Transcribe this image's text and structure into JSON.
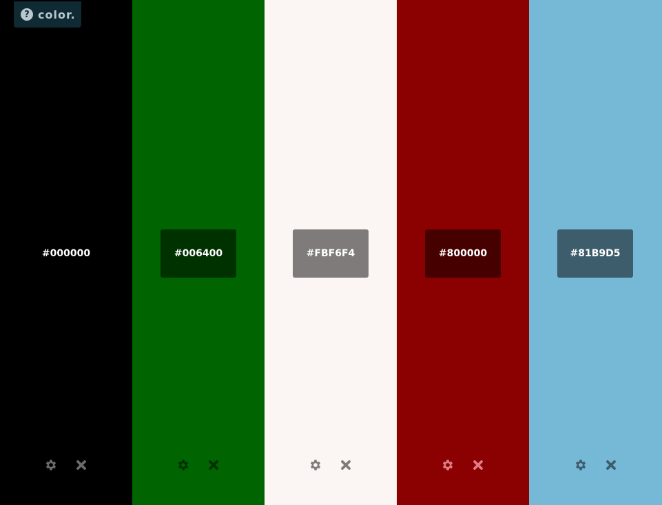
{
  "app": {
    "logo_text": "color.",
    "help_glyph": "?"
  },
  "colors": [
    {
      "hex": "#000000",
      "background": "#000000",
      "label_bg": "#000000",
      "icon_color": "#6b6b6b"
    },
    {
      "hex": "#006400",
      "background": "#006400",
      "label_bg": "#003200",
      "icon_color": "#003200"
    },
    {
      "hex": "#FBF6F4",
      "background": "#FBF6F4",
      "label_bg": "#7E7B7A",
      "icon_color": "#7E7B7A"
    },
    {
      "hex": "#800000",
      "background": "#8B0000",
      "label_bg": "#460000",
      "icon_color": "#e07c86"
    },
    {
      "hex": "#81B9D5",
      "background": "#76B9D7",
      "label_bg": "#3E5D6C",
      "icon_color": "#3E5D6C"
    }
  ],
  "icons": {
    "settings": "gear-icon",
    "remove": "close-icon"
  }
}
